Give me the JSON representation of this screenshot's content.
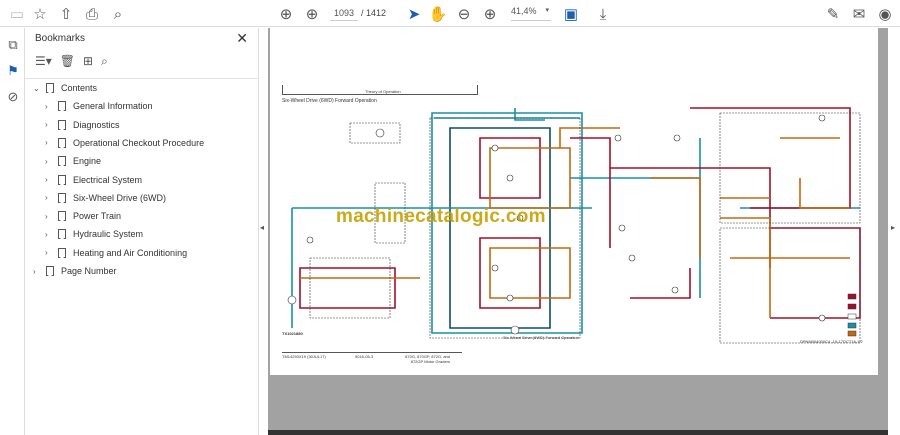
{
  "toolbar": {
    "current_page": "1093",
    "total_pages": "/ 1412",
    "zoom": "41,4%",
    "icons": [
      "save-icon",
      "bookmark-star-icon",
      "upload-icon",
      "print-icon",
      "search-icon",
      "page-up-icon",
      "page-down-icon",
      "select-cursor-icon",
      "hand-icon",
      "zoom-out-icon",
      "zoom-in-icon",
      "fit-page-icon",
      "scroll-mode-icon",
      "sign-icon",
      "mail-icon",
      "account-icon"
    ]
  },
  "bookmarks": {
    "title": "Bookmarks",
    "items": [
      {
        "label": "Contents",
        "level": 0,
        "expanded": true
      },
      {
        "label": "General Information",
        "level": 1
      },
      {
        "label": "Diagnostics",
        "level": 1
      },
      {
        "label": "Operational Checkout Procedure",
        "level": 1
      },
      {
        "label": "Engine",
        "level": 1
      },
      {
        "label": "Electrical System",
        "level": 1
      },
      {
        "label": "Six-Wheel Drive (6WD)",
        "level": 1
      },
      {
        "label": "Power Train",
        "level": 1
      },
      {
        "label": "Hydraulic System",
        "level": 1
      },
      {
        "label": "Heating and Air Conditioning",
        "level": 1
      },
      {
        "label": "Page Number",
        "level": 0
      }
    ]
  },
  "document": {
    "header": "Theory of Operation",
    "title": "Six-Wheel Drive (6WD) Forward Operation",
    "figure_id": "TX1021880",
    "caption": "Six-Wheel Drive (6WD) Forward Operation",
    "ref": "DPNM004000C4 -19-17OCT16-1/2",
    "footer_left": "TM14293X19 (30JUL17)",
    "footer_mid": "9016-05-3",
    "footer_right": "870G, 870GP, 872G, and 872GP Motor Graders",
    "watermark": "machinecatalogic.com",
    "colors": {
      "pressure": "#a0102a",
      "return": "#1a8fa8",
      "pilot": "#c06a10",
      "drain": "#555555"
    }
  }
}
